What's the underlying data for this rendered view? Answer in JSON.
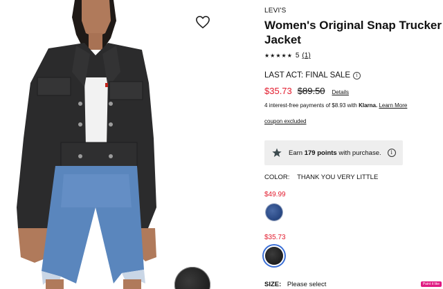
{
  "product": {
    "brand": "LEVI'S",
    "title": "Women's Original Snap Trucker Jacket",
    "stars": "★★★★★",
    "rating_value": "5",
    "rating_count": "(1)",
    "sale_label": "LAST ACT: FINAL SALE",
    "price_sale": "$35.73",
    "price_original": "$89.50",
    "details_link": "Details",
    "klarna_prefix": "4 interest-free payments of $8.93 with ",
    "klarna_brand": "Klarna.",
    "klarna_learn": "Learn More",
    "coupon": "coupon excluded",
    "earn_prefix": "Earn ",
    "earn_points": "179 points",
    "earn_suffix": " with purchase.",
    "color_label": "COLOR:",
    "color_value": "THANK YOU VERY LITTLE",
    "swatches": [
      {
        "price": "$49.99",
        "color": "#2b4a86"
      },
      {
        "price": "$35.73",
        "color": "#222222"
      }
    ],
    "size_label": "SIZE:",
    "size_value": "Please select"
  },
  "badge": "Paint it like",
  "colors": {
    "sale_red": "#e21a2c",
    "selected_ring": "#3b6fd6",
    "earn_box_bg": "#eeeeee"
  },
  "icons": {
    "wishlist": "heart-outline-icon",
    "sale_info": "info-icon",
    "earn": "star-icon",
    "earn_info": "info-icon"
  }
}
